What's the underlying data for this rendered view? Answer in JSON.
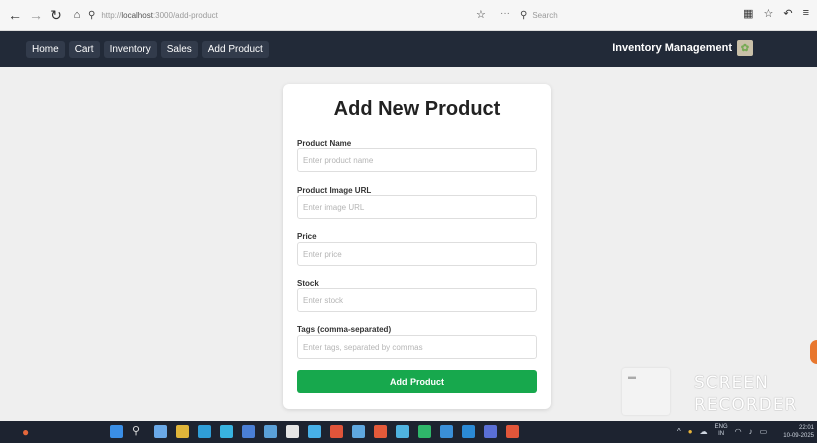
{
  "browser": {
    "url_prefix": "http://",
    "url_host": "localhost",
    "url_path": ":3000/add-product",
    "search_placeholder": "Search"
  },
  "navbar": {
    "links": [
      "Home",
      "Cart",
      "Inventory",
      "Sales",
      "Add Product"
    ],
    "brand": "Inventory Management"
  },
  "form": {
    "title": "Add New Product",
    "fields": [
      {
        "label": "Product Name",
        "placeholder": "Enter product name"
      },
      {
        "label": "Product Image URL",
        "placeholder": "Enter image URL"
      },
      {
        "label": "Price",
        "placeholder": "Enter price"
      },
      {
        "label": "Stock",
        "placeholder": "Enter stock"
      },
      {
        "label": "Tags (comma-separated)",
        "placeholder": "Enter tags, separated by commas"
      }
    ],
    "submit_label": "Add Product"
  },
  "watermark": {
    "line1": "SCREEN",
    "line2": "RECORDER"
  },
  "taskbar": {
    "lang_top": "ENG",
    "lang_bottom": "IN",
    "time": "22:01",
    "date": "10-09-2025"
  },
  "colors": {
    "navbar_bg": "#222a38",
    "submit_bg": "#17a84d",
    "taskbar_bg": "#1d2330"
  },
  "icons": {
    "back": "back-arrow-icon",
    "forward": "forward-arrow-icon",
    "reload": "reload-icon",
    "home": "home-icon",
    "search": "search-icon",
    "bookmark": "star-icon",
    "menu": "hamburger-icon"
  }
}
